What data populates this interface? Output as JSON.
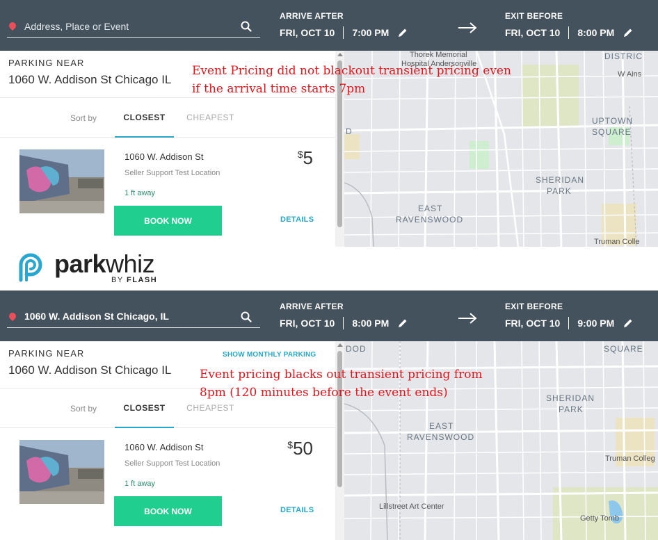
{
  "logo": {
    "brand_bold": "park",
    "brand_light": "whiz",
    "byline": "BY",
    "byline_brand": "FLASH"
  },
  "colors": {
    "header_bg": "#44525e",
    "book_button": "#20cf8f",
    "link_accent": "#29a6c6",
    "annotation_red": "#e0161c",
    "pin_red": "#e8505b"
  },
  "panels": [
    {
      "search": {
        "placeholder": "Address, Place or Event",
        "value": ""
      },
      "arrive": {
        "label": "ARRIVE AFTER",
        "date": "FRI, OCT 10",
        "time": "7:00 PM"
      },
      "exit": {
        "label": "EXIT BEFORE",
        "date": "FRI, OCT 10",
        "time": "8:00 PM"
      },
      "parking_near_label": "PARKING NEAR",
      "address": "1060 W. Addison St Chicago IL",
      "monthly_link": "",
      "sort": {
        "label": "Sort by",
        "active": "CLOSEST",
        "inactive": "CHEAPEST"
      },
      "listing": {
        "title": "1060 W. Addison St",
        "subtitle": "Seller Support Test Location",
        "distance": "1 ft away",
        "currency": "$",
        "price": "5",
        "book_label": "BOOK NOW",
        "details_label": "DETAILS"
      },
      "annotation": [
        "Event Pricing did not blackout transient pricing even",
        "if the arrival time starts 7pm"
      ],
      "map_labels": {
        "hospital_1": "Thorek Memorial",
        "hospital_2": "Hospital Andersonville",
        "district": "DISTRIC",
        "ainslie": "W Ains",
        "uptown_1": "UPTOWN",
        "uptown_2": "SQUARE",
        "sheridan_1": "SHERIDAN",
        "sheridan_2": "PARK",
        "east_rav_1": "EAST",
        "east_rav_2": "RAVENSWOOD",
        "truman": "Truman Colle",
        "left_edge": "D"
      }
    },
    {
      "search": {
        "placeholder": "Address, Place or Event",
        "value": "1060 W. Addison St Chicago, IL"
      },
      "arrive": {
        "label": "ARRIVE AFTER",
        "date": "FRI, OCT 10",
        "time": "8:00 PM"
      },
      "exit": {
        "label": "EXIT BEFORE",
        "date": "FRI, OCT 10",
        "time": "9:00 PM"
      },
      "parking_near_label": "PARKING NEAR",
      "address": "1060 W. Addison St Chicago IL",
      "monthly_link": "SHOW MONTHLY PARKING",
      "sort": {
        "label": "Sort by",
        "active": "CLOSEST",
        "inactive": "CHEAPEST"
      },
      "listing": {
        "title": "1060 W. Addison St",
        "subtitle": "Seller Support Test Location",
        "distance": "1 ft away",
        "currency": "$",
        "price": "50",
        "book_label": "BOOK NOW",
        "details_label": "DETAILS"
      },
      "annotation": [
        "Event pricing blacks out transient pricing from",
        "8pm (120 minutes before the event ends)"
      ],
      "map_labels": {
        "square": "SQUARE",
        "sheridan_1": "SHERIDAN",
        "sheridan_2": "PARK",
        "east_rav_1": "EAST",
        "east_rav_2": "RAVENSWOOD",
        "truman": "Truman Colleg",
        "lillstreet": "Lillstreet Art Center",
        "getty": "Getty Tomb",
        "left_edge": "DOD"
      }
    }
  ]
}
